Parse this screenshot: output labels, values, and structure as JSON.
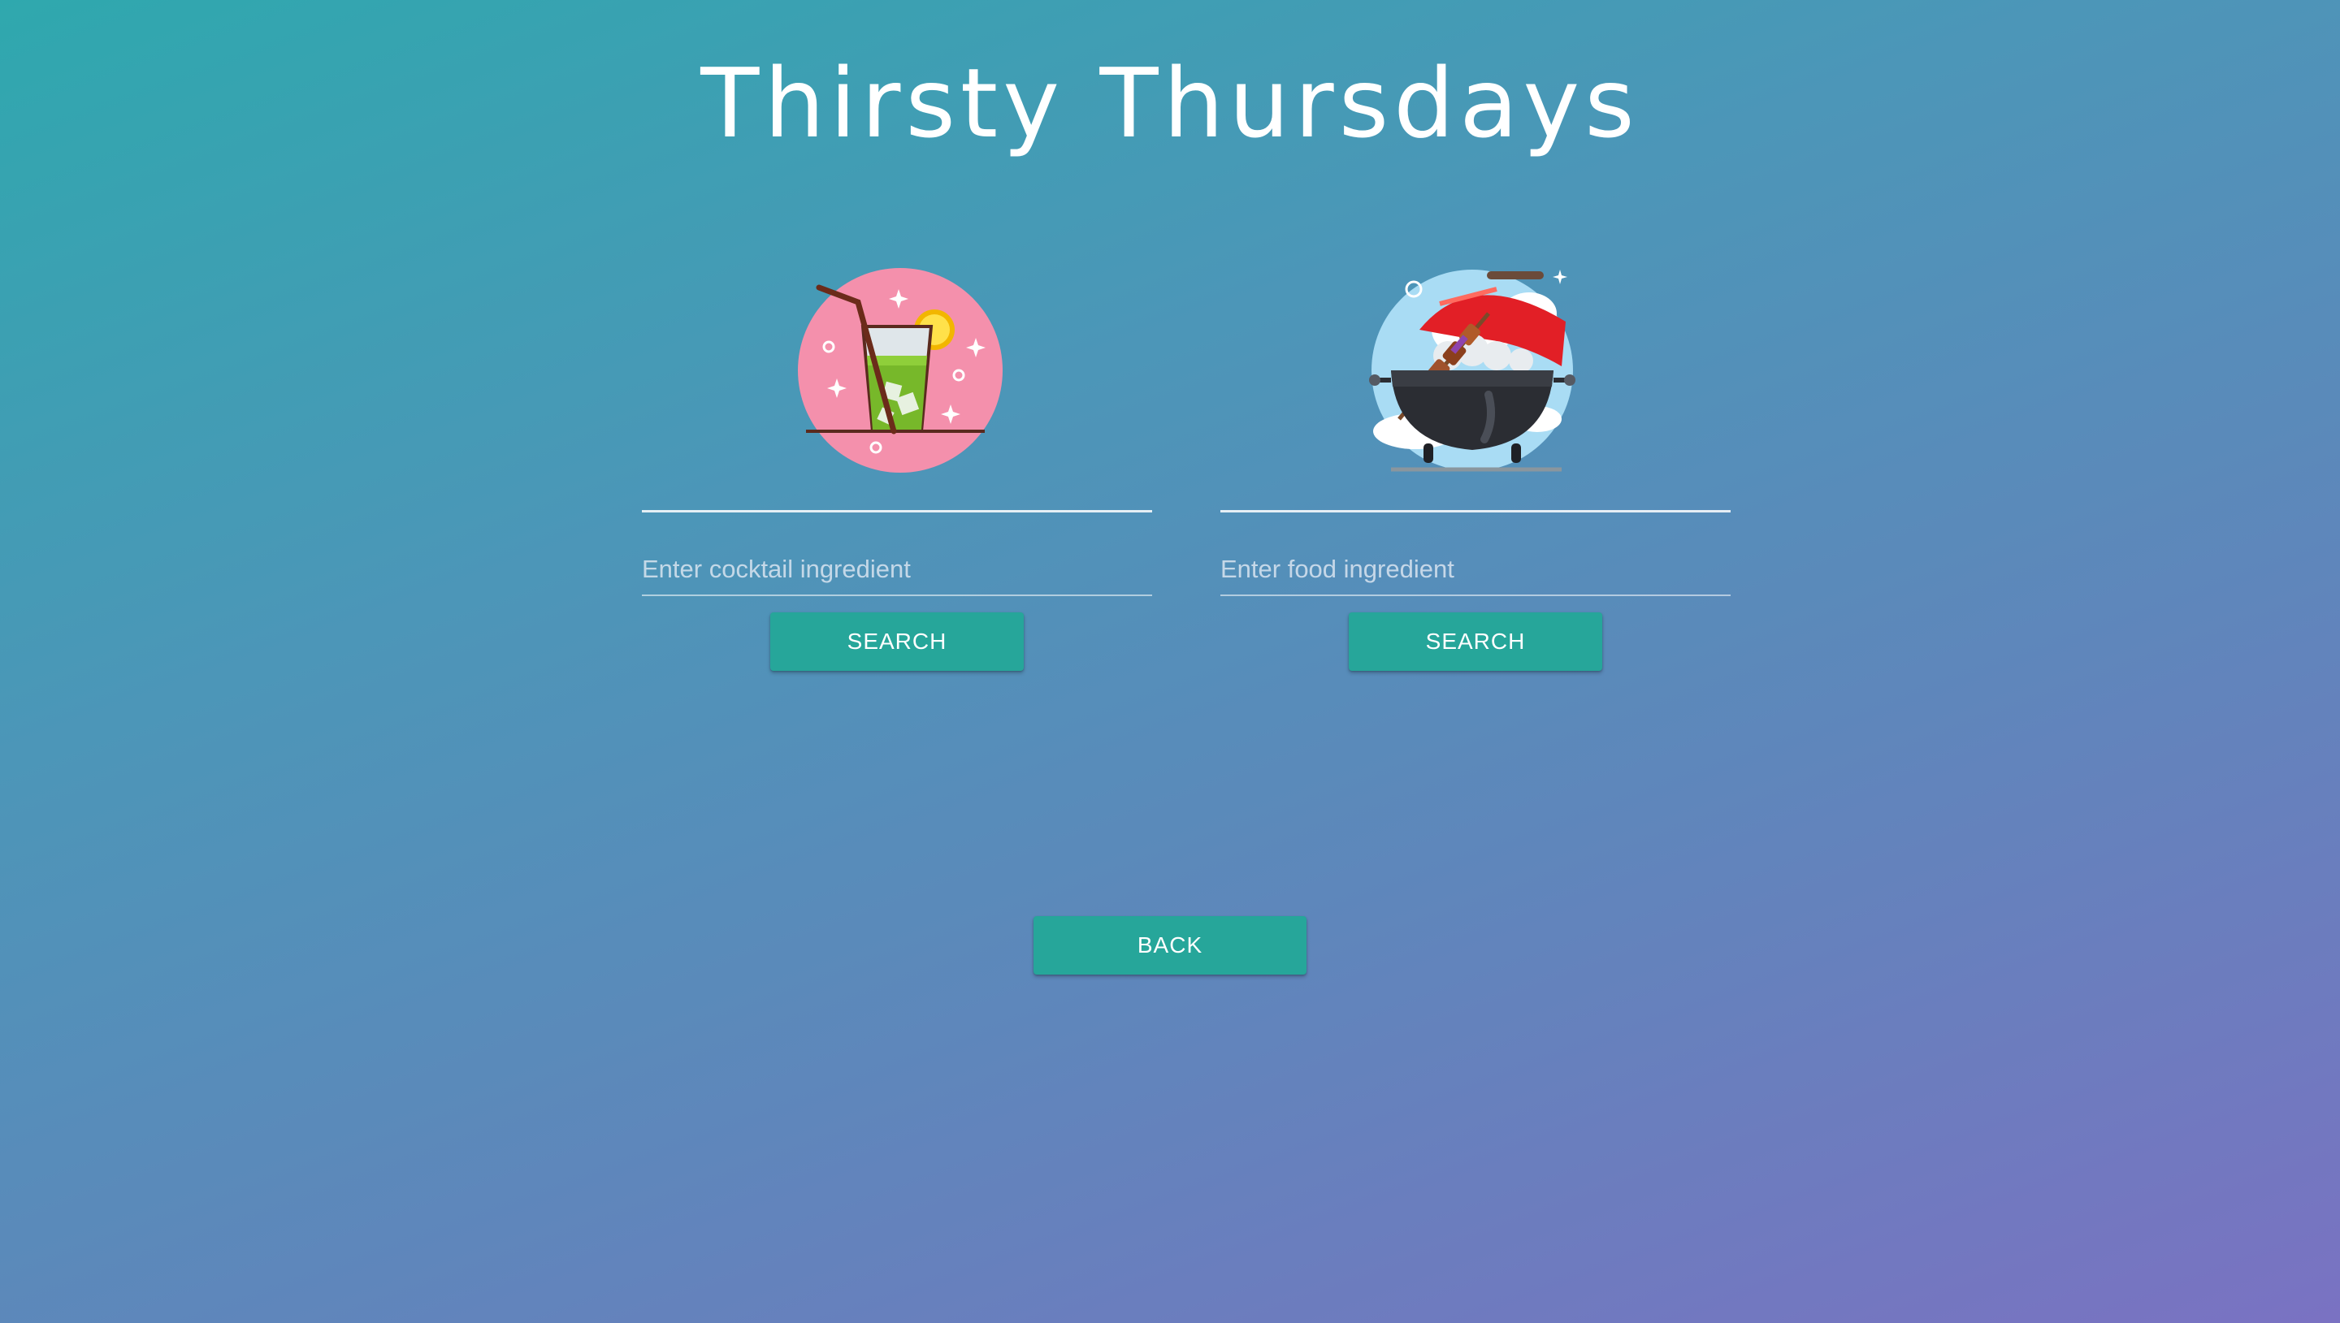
{
  "header": {
    "title": "Thirsty Thursdays"
  },
  "cocktail": {
    "icon": "cocktail-glass-icon",
    "placeholder": "Enter cocktail ingredient",
    "value": "",
    "search_label": "SEARCH"
  },
  "food": {
    "icon": "bbq-grill-icon",
    "placeholder": "Enter food ingredient",
    "value": "",
    "search_label": "SEARCH"
  },
  "footer": {
    "back_label": "BACK"
  },
  "colors": {
    "accent": "#26a69a",
    "cocktail_circle": "#f48fb1",
    "grill_circle": "#a8dcf5"
  }
}
